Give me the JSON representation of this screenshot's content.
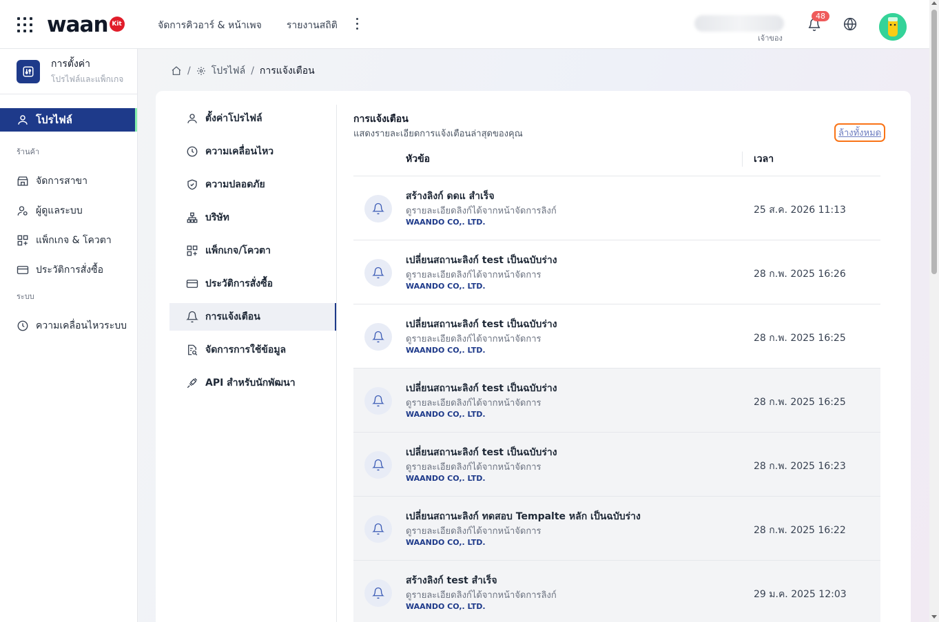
{
  "header": {
    "logo_text": "waan",
    "logo_badge": "Kit",
    "nav": [
      "จัดการคิวอาร์ & หน้าเพจ",
      "รายงานสถิติ"
    ],
    "user_role": "เจ้าของ",
    "notification_count": "48"
  },
  "sidebar": {
    "title": "การตั้งค่า",
    "subtitle": "โปรไฟล์และแพ็กเกจ",
    "active_item": "โปรไฟล์",
    "group_store": "ร้านค้า",
    "store_items": [
      "จัดการสาขา",
      "ผู้ดูแลระบบ",
      "แพ็กเกจ & โควตา",
      "ประวัติการสั่งซื้อ"
    ],
    "group_system": "ระบบ",
    "system_items": [
      "ความเคลื่อนไหวระบบ"
    ]
  },
  "breadcrumb": {
    "level1": "โปรไฟล์",
    "level2": "การแจ้งเตือน"
  },
  "menu": {
    "items": [
      "ตั้งค่าโปรไฟล์",
      "ความเคลื่อนไหว",
      "ความปลอดภัย",
      "บริษัท",
      "แพ็กเกจ/โควตา",
      "ประวัติการสั่งซื้อ",
      "การแจ้งเตือน",
      "จัดการการใช้ข้อมูล",
      "API สำหรับนักพัฒนา"
    ]
  },
  "notifications": {
    "title": "การแจ้งเตือน",
    "subtitle": "แสดงรายละเอียดการแจ้งเตือนล่าสุดของคุณ",
    "clear_all": "ล้างทั้งหมด",
    "col_subject": "หัวข้อ",
    "col_time": "เวลา",
    "rows": [
      {
        "title": "สร้างลิงก์ ดดแ สำเร็จ",
        "desc": "ดูรายละเอียดลิงก์ได้จากหน้าจัดการลิงก์",
        "company": "WAANDO CO,. LTD.",
        "time": "25 ส.ค. 2026 11:13"
      },
      {
        "title": "เปลี่ยนสถานะลิงก์ test เป็นฉบับร่าง",
        "desc": "ดูรายละเอียดลิงก์ได้จากหน้าจัดการ",
        "company": "WAANDO CO,. LTD.",
        "time": "28 ก.พ. 2025 16:26"
      },
      {
        "title": "เปลี่ยนสถานะลิงก์ test เป็นฉบับร่าง",
        "desc": "ดูรายละเอียดลิงก์ได้จากหน้าจัดการ",
        "company": "WAANDO CO,. LTD.",
        "time": "28 ก.พ. 2025 16:25"
      },
      {
        "title": "เปลี่ยนสถานะลิงก์ test เป็นฉบับร่าง",
        "desc": "ดูรายละเอียดลิงก์ได้จากหน้าจัดการ",
        "company": "WAANDO CO,. LTD.",
        "time": "28 ก.พ. 2025 16:25"
      },
      {
        "title": "เปลี่ยนสถานะลิงก์ test เป็นฉบับร่าง",
        "desc": "ดูรายละเอียดลิงก์ได้จากหน้าจัดการ",
        "company": "WAANDO CO,. LTD.",
        "time": "28 ก.พ. 2025 16:23"
      },
      {
        "title": "เปลี่ยนสถานะลิงก์ ทดสอบ Tempalte หลัก เป็นฉบับร่าง",
        "desc": "ดูรายละเอียดลิงก์ได้จากหน้าจัดการ",
        "company": "WAANDO CO,. LTD.",
        "time": "28 ก.พ. 2025 16:22"
      },
      {
        "title": "สร้างลิงก์ test สำเร็จ",
        "desc": "ดูรายละเอียดลิงก์ได้จากหน้าจัดการลิงก์",
        "company": "WAANDO CO,. LTD.",
        "time": "29 ม.ค. 2025 12:03"
      }
    ]
  },
  "colors": {
    "primary": "#1e3a8a",
    "badge": "#ef5b5b",
    "highlight_border": "#f97316"
  }
}
